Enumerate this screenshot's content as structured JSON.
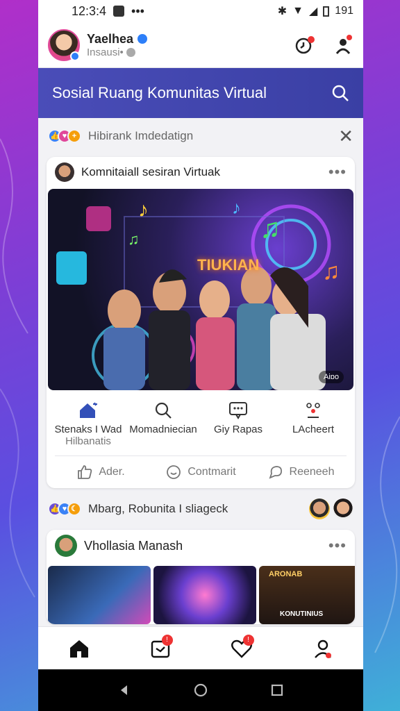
{
  "status": {
    "time": "12:3:4",
    "right_text": "191"
  },
  "user": {
    "name": "Yaelhea",
    "subtitle": "Insausi•"
  },
  "banner": {
    "title": "Sosial Ruang Komunitas Virtual"
  },
  "filter": {
    "text": "Hibirank Imdedatign"
  },
  "post": {
    "title": "Komnitaiall sesiran Virtuak",
    "image_sign": "TIUKIAN",
    "watermark": "Aiɒo",
    "actions": [
      {
        "label": "Stenaks I Wad",
        "sub": "Hilbanatis"
      },
      {
        "label": "Momadniecian",
        "sub": ""
      },
      {
        "label": "Giy Rapas",
        "sub": ""
      },
      {
        "label": "LAcheert",
        "sub": ""
      }
    ],
    "bottom_actions": [
      "Ader.",
      "Contmarit",
      "Reeneeh"
    ]
  },
  "section2": {
    "text": "Mbarg, Robunita I sliageck"
  },
  "post2": {
    "title": "Vhollasia Manash",
    "thumb_label": "ARONAB",
    "thumb_label2": "KONUTINIUS"
  },
  "colors": {
    "accent": "#4a4db8",
    "notify": "#e33333"
  }
}
